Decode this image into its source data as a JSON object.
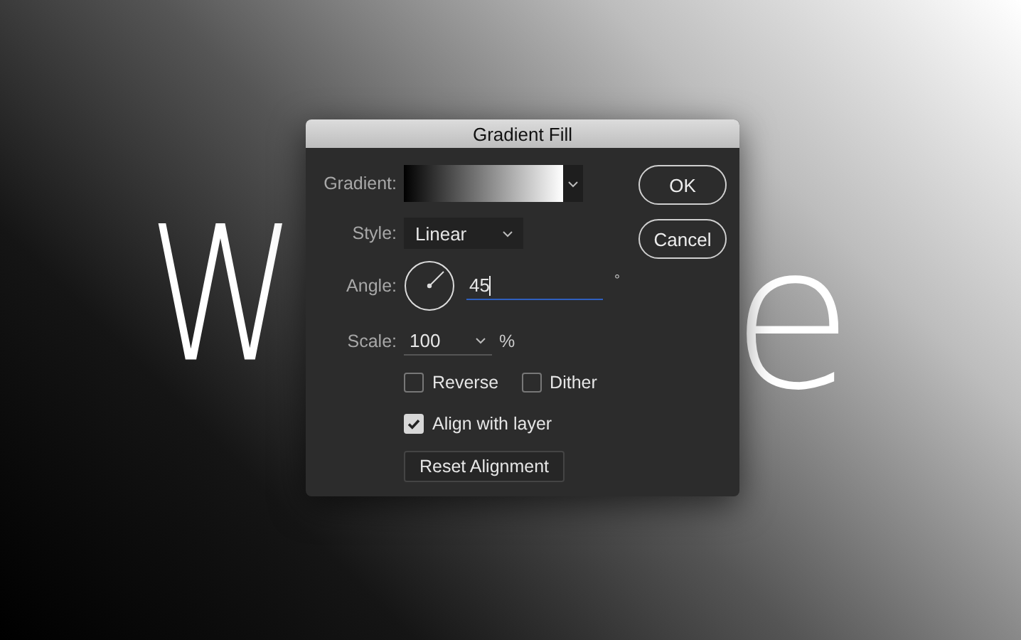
{
  "canvas": {
    "text_left": "W",
    "text_right": "e"
  },
  "dialog": {
    "title": "Gradient Fill",
    "gradient": {
      "label": "Gradient:"
    },
    "style": {
      "label": "Style:",
      "value": "Linear"
    },
    "angle": {
      "label": "Angle:",
      "value": "45",
      "unit": "°"
    },
    "scale": {
      "label": "Scale:",
      "value": "100",
      "unit": "%"
    },
    "checkbox_rows": [
      [
        {
          "label": "Reverse",
          "checked": false
        },
        {
          "label": "Dither",
          "checked": false
        }
      ],
      [
        {
          "label": "Align with layer",
          "checked": true
        }
      ]
    ],
    "reset_button": "Reset Alignment",
    "buttons": [
      "OK",
      "Cancel"
    ]
  }
}
